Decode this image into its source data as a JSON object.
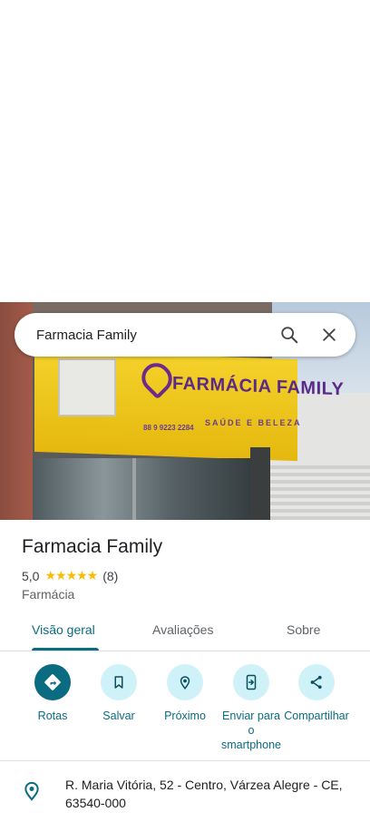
{
  "search": {
    "query": "Farmacia Family"
  },
  "place": {
    "name": "Farmacia Family",
    "rating": "5,0",
    "stars": "★★★★★",
    "reviews_count": "(8)",
    "category": "Farmácia"
  },
  "photo_sign": {
    "brand": "FARMÁCIA FAMILY",
    "tagline": "SAÚDE E BELEZA",
    "phone": "88 9 9223 2284"
  },
  "tabs": [
    {
      "label": "Visão geral",
      "active": true
    },
    {
      "label": "Avaliações",
      "active": false
    },
    {
      "label": "Sobre",
      "active": false
    }
  ],
  "actions": [
    {
      "label": "Rotas",
      "icon": "directions-icon"
    },
    {
      "label": "Salvar",
      "icon": "bookmark-icon"
    },
    {
      "label": "Próximo",
      "icon": "nearby-icon"
    },
    {
      "label": "Enviar para o smartphone",
      "icon": "send-to-phone-icon"
    },
    {
      "label": "Compartilhar",
      "icon": "share-icon"
    }
  ],
  "address": "R. Maria Vitória, 52 - Centro, Várzea Alegre - CE, 63540-000",
  "colors": {
    "accent": "#0b6b80",
    "accent_light": "#cff2f8",
    "star": "#fbbc04"
  }
}
